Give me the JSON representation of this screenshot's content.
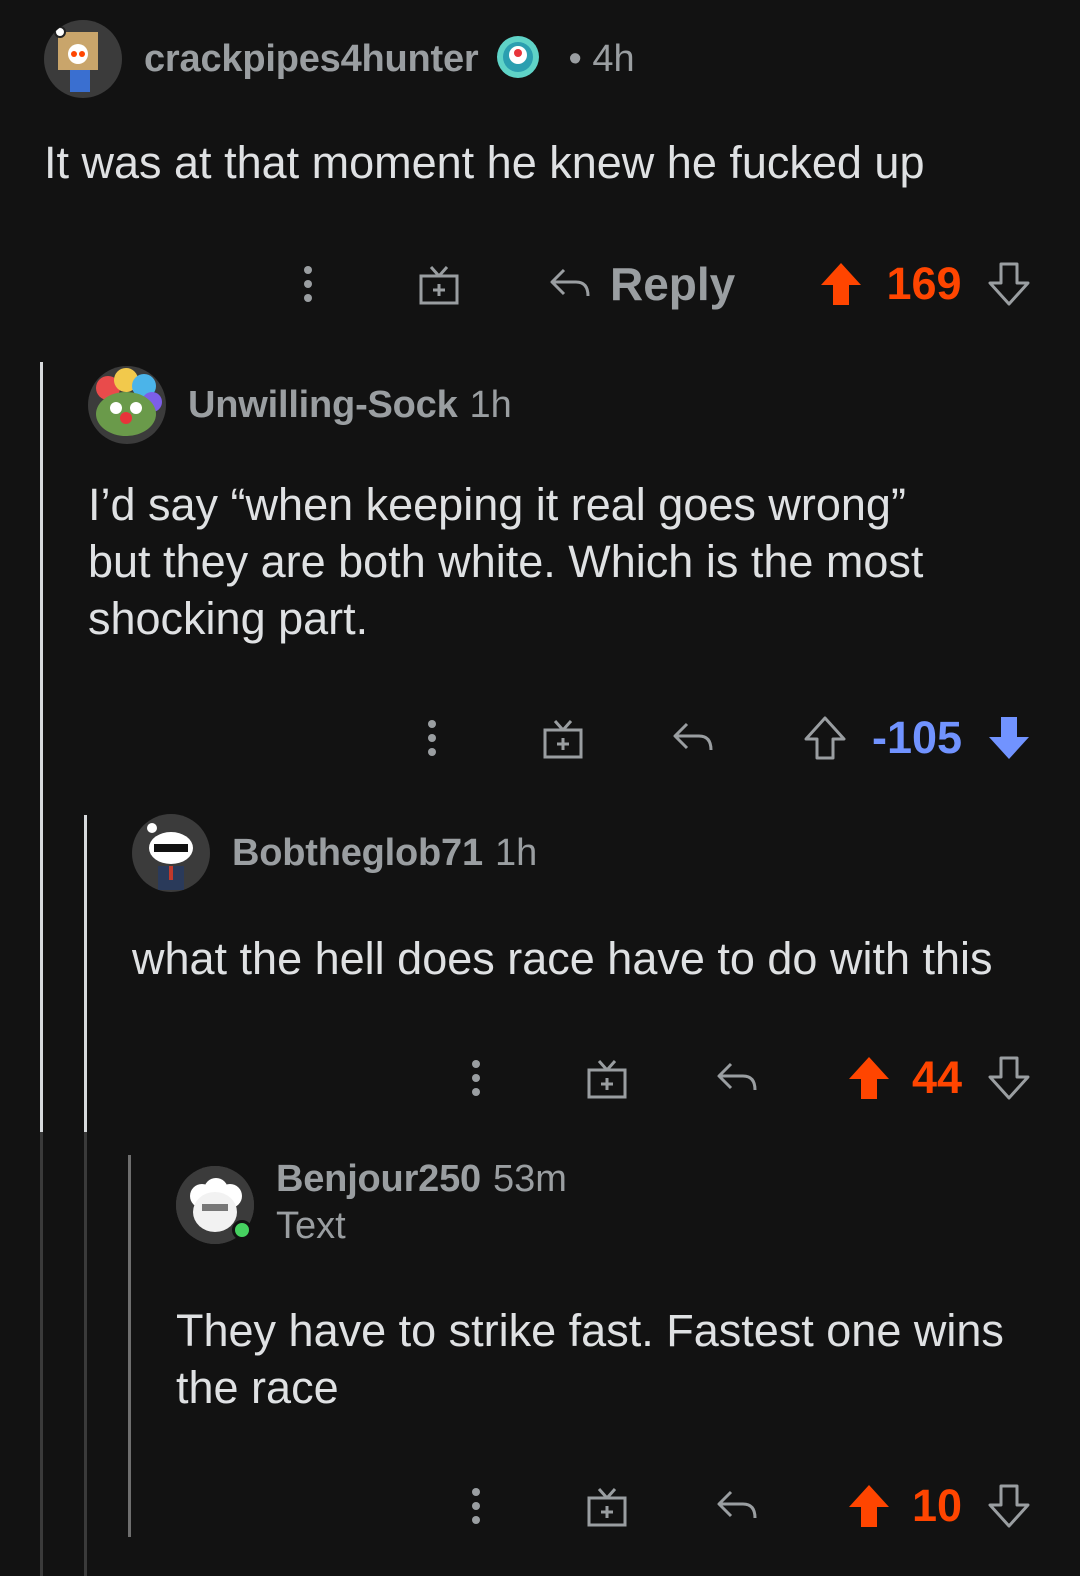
{
  "colors": {
    "background": "#121212",
    "text": "#dfe1e3",
    "meta": "#9a9ea1",
    "upvote": "#ff4500",
    "downvote": "#7193ff",
    "thread_line": "#d7dadc",
    "online": "#46d160"
  },
  "comments": [
    {
      "username": "crackpipes4hunter",
      "time": "• 4h",
      "flair_icon": "achievement-badge-icon",
      "body": "It was at that moment he knew he fucked up",
      "reply_label": "Reply",
      "score": "169",
      "vote": "up"
    },
    {
      "username": "Unwilling-Sock",
      "time": "1h",
      "body": "I’d say “when keeping it real goes wrong”\nbut they are both white. Which is the most\nshocking part.",
      "score": "-105",
      "vote": "down"
    },
    {
      "username": "Bobtheglob71",
      "time": "1h",
      "body": "what the hell does race have to do with this",
      "score": "44",
      "vote": "up"
    },
    {
      "username": "Benjour250",
      "time": "53m",
      "flair_text": "Text",
      "body": "They have to strike fast. Fastest one wins\nthe race",
      "score": "10",
      "vote": "up"
    }
  ]
}
